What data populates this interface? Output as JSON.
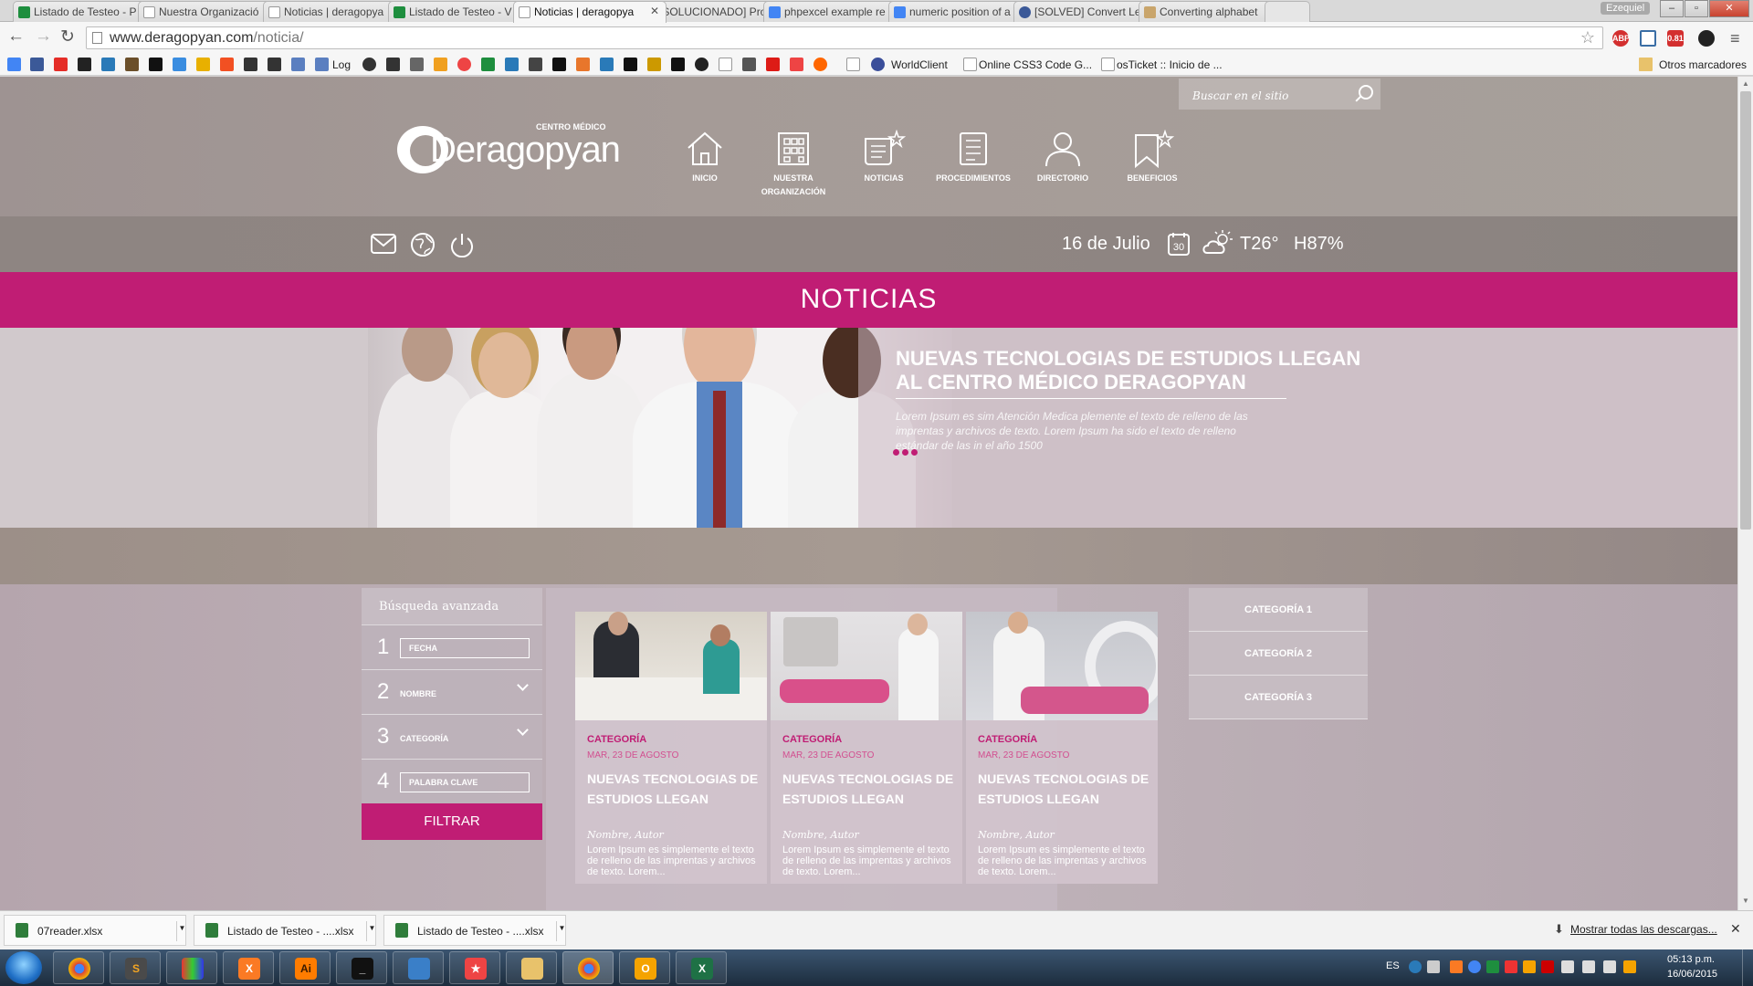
{
  "browser": {
    "tabs": [
      {
        "label": "Listado de Testeo - P",
        "color": "#1e8e3e"
      },
      {
        "label": "Nuestra Organizació",
        "color": "#999999"
      },
      {
        "label": "Noticias | deragopya",
        "color": "#999999"
      },
      {
        "label": "Listado de Testeo - V",
        "color": "#1e8e3e"
      },
      {
        "label": "Noticias | deragopya",
        "color": "#999999"
      },
      {
        "label": "[SOLUCIONADO] Pro",
        "color": "#27a1a8"
      },
      {
        "label": "phpexcel example re",
        "color": "#4285f4"
      },
      {
        "label": "numeric position of a",
        "color": "#4285f4"
      },
      {
        "label": "[SOLVED] Convert Le",
        "color": "#3b5998"
      },
      {
        "label": "Converting alphabet",
        "color": "#c9a56b"
      }
    ],
    "active_tab_index": 4,
    "user_badge": "Ezequiel",
    "url_domain": "www.deragopyan.com",
    "url_path": "/noticia/",
    "ext_badge": "0.81",
    "bookmarks": [
      {
        "label": "Log",
        "color": "#5b7fc0"
      },
      {
        "label": "WorldClient",
        "color": "#3a4e9a"
      },
      {
        "label": "Online CSS3 Code G...",
        "color": "#ffffff"
      },
      {
        "label": "osTicket :: Inicio de ...",
        "color": "#ffffff"
      }
    ],
    "other_bookmarks": "Otros marcadores"
  },
  "site": {
    "search_placeholder": "Buscar en el sitio",
    "logo_text": "Deragopyan",
    "logo_sub": "CENTRO MÉDICO",
    "nav": [
      {
        "label": "INICIO",
        "icon": "home-icon"
      },
      {
        "label": "NUESTRA ORGANIZACIÓN",
        "icon": "building-icon"
      },
      {
        "label": "NOTICIAS",
        "icon": "news-icon"
      },
      {
        "label": "PROCEDIMIENTOS",
        "icon": "list-icon"
      },
      {
        "label": "DIRECTORIO",
        "icon": "person-icon"
      },
      {
        "label": "BENEFICIOS",
        "icon": "bookmark-icon"
      }
    ],
    "date": "16 de Julio",
    "calendar_day": "30",
    "temperature": "T26°",
    "humidity": "H87%",
    "section_title": "NOTICIAS",
    "hero": {
      "title": "NUEVAS TECNOLOGIAS DE ESTUDIOS LLEGAN AL CENTRO MÉDICO DERAGOPYAN",
      "text": "Lorem Ipsum es sim Atención Medica plemente el texto de relleno de las imprentas y archivos de texto. Lorem Ipsum ha sido el texto de relleno estándar de las in el año 1500"
    },
    "filter": {
      "heading": "Búsqueda avanzada",
      "rows": [
        {
          "num": "1",
          "label": "FECHA",
          "type": "input"
        },
        {
          "num": "2",
          "label": "NOMBRE",
          "type": "select"
        },
        {
          "num": "3",
          "label": "CATEGORÍA",
          "type": "select"
        },
        {
          "num": "4",
          "label": "PALABRA CLAVE",
          "type": "input"
        }
      ],
      "button": "FILTRAR"
    },
    "cards": [
      {
        "category": "CATEGORÍA",
        "date": "MAR, 23 DE AGOSTO",
        "title": "NUEVAS TECNOLOGIAS DE ESTUDIOS LLEGAN",
        "author": "Nombre, Autor",
        "text": "Lorem Ipsum es simplemente el texto de relleno de las imprentas y archivos de texto. Lorem..."
      },
      {
        "category": "CATEGORÍA",
        "date": "MAR, 23 DE AGOSTO",
        "title": "NUEVAS TECNOLOGIAS DE ESTUDIOS LLEGAN",
        "author": "Nombre, Autor",
        "text": "Lorem Ipsum es simplemente el texto de relleno de las imprentas y archivos de texto. Lorem..."
      },
      {
        "category": "CATEGORÍA",
        "date": "MAR, 23 DE AGOSTO",
        "title": "NUEVAS TECNOLOGIAS DE ESTUDIOS LLEGAN",
        "author": "Nombre, Autor",
        "text": "Lorem Ipsum es simplemente el texto de relleno de las imprentas y archivos de texto. Lorem..."
      }
    ],
    "categories": [
      "CATEGORÍA 1",
      "CATEGORÍA 2",
      "CATEGORÍA 3"
    ],
    "accent_color": "#c01d74"
  },
  "downloads": {
    "items": [
      "07reader.xlsx",
      "Listado de Testeo - ....xlsx",
      "Listado de Testeo - ....xlsx"
    ],
    "show_all": "Mostrar todas las descargas..."
  },
  "taskbar": {
    "lang": "ES",
    "time": "05:13 p.m.",
    "date": "16/06/2015"
  }
}
